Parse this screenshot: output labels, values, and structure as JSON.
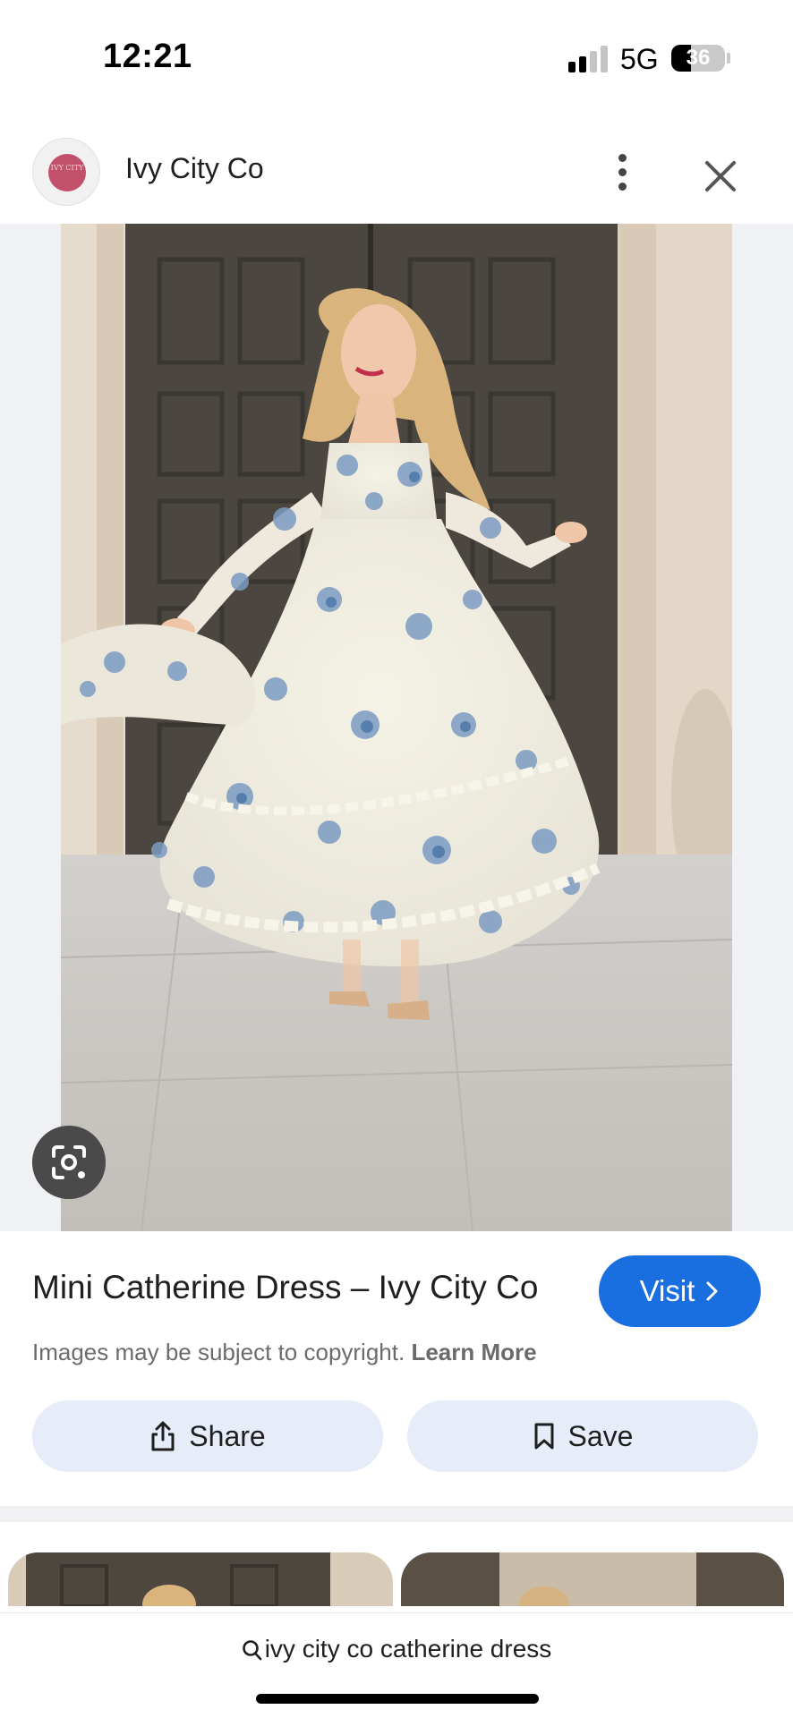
{
  "status_bar": {
    "time": "12:21",
    "network": "5G",
    "battery": "36",
    "battery_level_percent": 36
  },
  "header": {
    "site_name": "Ivy City Co",
    "avatar_text": "IVY CITY"
  },
  "result": {
    "title": "Mini Catherine Dress – Ivy City Co",
    "visit_label": "Visit",
    "copyright_text": "Images may be subject to copyright.",
    "learn_more_label": "Learn More",
    "share_label": "Share",
    "save_label": "Save"
  },
  "search": {
    "query": "ivy city co catherine dress"
  },
  "icons": {
    "more": "more-vertical-icon",
    "close": "close-icon",
    "lens": "lens-icon",
    "visit": "chevron-right-icon",
    "share": "share-icon",
    "save": "bookmark-icon",
    "search": "search-icon"
  },
  "colors": {
    "accent": "#1a6fe0",
    "button_bg": "#e6edf9",
    "avatar": "#c2506b"
  }
}
